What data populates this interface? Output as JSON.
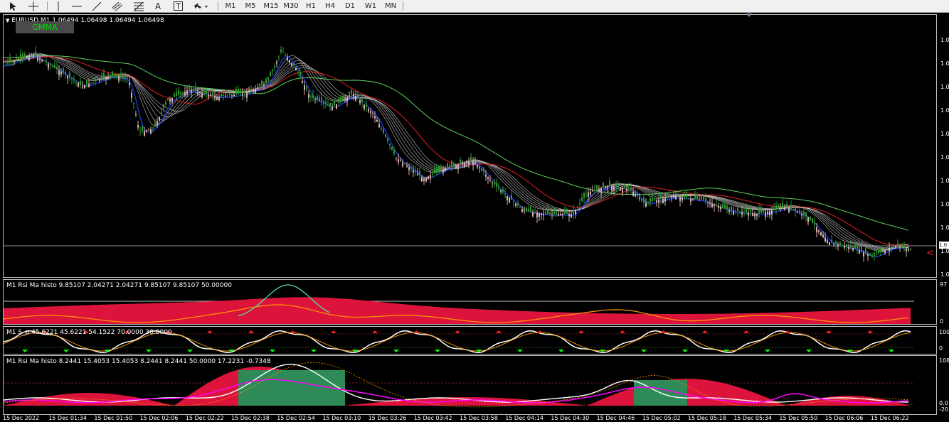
{
  "toolbar": {
    "tools": [
      {
        "name": "cursor-icon"
      },
      {
        "name": "crosshair-icon"
      },
      {
        "name": "vertical-line-icon"
      },
      {
        "name": "horizontal-line-icon"
      },
      {
        "name": "trendline-icon"
      },
      {
        "name": "channel-icon"
      },
      {
        "name": "fibonacci-icon"
      },
      {
        "name": "text-icon"
      },
      {
        "name": "text-label-icon"
      },
      {
        "name": "arrows-icon"
      }
    ],
    "text_tool": "A",
    "timeframes": [
      "M1",
      "M5",
      "M15",
      "M30",
      "H1",
      "H4",
      "D1",
      "W1",
      "MN"
    ]
  },
  "main_panel": {
    "header": "EURUSD,M1  1.06494 1.06498 1.06494 1.06498",
    "gmma_button": "GMMA",
    "price_labels": [
      "1.0",
      "1.0",
      "1.0",
      "1.0",
      "1.0",
      "1.0",
      "1.0",
      "1.0",
      "1.0",
      "1.0",
      "1.0"
    ],
    "current_price_label": "1.0",
    "arrow_marker": "<"
  },
  "rsi_panel": {
    "header": "M1 Rsi Ma histo 9.85107 2.04271 2.04271 9.85107 9.85107 50.00000",
    "scale_top": "97",
    "scale_bottom": "0"
  },
  "stoch_panel": {
    "header": "M1 S_p 45.6221 45.6221 54.1522 70.0000 30.0000",
    "scale_top": "100",
    "scale_bottom": "0"
  },
  "rsi2_panel": {
    "header": "M1 Rsi Ma histo 8.2441 15.4053 15.4053 8.2441 8.2441 50.0000 17.2231 -0.7348",
    "scale_top": "108",
    "scale_mid": "0.0",
    "scale_bottom": "-20"
  },
  "time_axis": [
    "15 Dec 2022",
    "15 Dec 01:34",
    "15 Dec 01:50",
    "15 Dec 02:06",
    "15 Dec 02:22",
    "15 Dec 02:38",
    "15 Dec 02:54",
    "15 Dec 03:10",
    "15 Dec 03:26",
    "15 Dec 03:42",
    "15 Dec 03:58",
    "15 Dec 04:14",
    "15 Dec 04:30",
    "15 Dec 04:46",
    "15 Dec 05:02",
    "15 Dec 05:18",
    "15 Dec 05:34",
    "15 Dec 05:50",
    "15 Dec 06:06",
    "15 Dec 06:22"
  ],
  "colors": {
    "bull_candle": "#2e9b2e",
    "bear_candle": "#d8b0b0",
    "fast_ema": "#1a3cff",
    "slow_ema_red": "#e02020",
    "long_ema_green": "#5ed35e",
    "ribbon": "#d0d0d0",
    "histo_red": "#dc143c",
    "histo_green": "#2e8b57",
    "rsi_orange": "#ff9900",
    "rsi_cyan": "#55e0a0",
    "stoch_white": "#ffffff",
    "magenta": "#ff00ff",
    "arrow_up": "#00ff00",
    "arrow_down": "#ff2020"
  }
}
